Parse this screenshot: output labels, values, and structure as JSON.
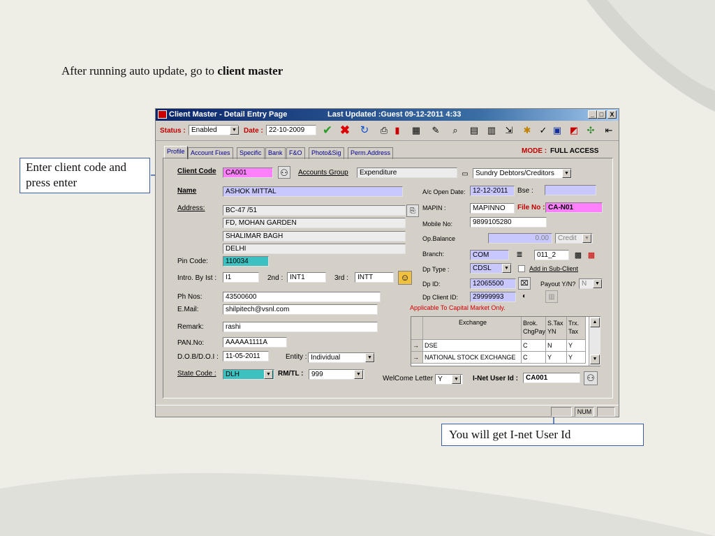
{
  "slide": {
    "title_text": "After running auto update, go to",
    "title_bold": "client  master",
    "callout_left": "Enter client code and press enter",
    "callout_bottom": "You will get I-net User Id"
  },
  "window": {
    "title": "Client Master - Detail Entry Page",
    "last_updated": "Last Updated :Guest  09-12-2011 4:33",
    "controls": {
      "min": "_",
      "max": "□",
      "close": "X"
    }
  },
  "toolbar": {
    "status_label": "Status :",
    "status_value": "Enabled",
    "date_label": "Date :",
    "date_value": "22-10-2009"
  },
  "tabs": [
    "Profile",
    "Account Fixes",
    "Specific",
    "Bank",
    "F&O",
    "Photo&Sig",
    "Perm.Address"
  ],
  "mode": {
    "label": "MODE :",
    "value": "FULL ACCESS"
  },
  "form": {
    "client_code_label": "Client Code",
    "client_code": "CA001",
    "accounts_group_label": "Accounts Group",
    "accounts_group": "Expenditure",
    "sundry": "Sundry Debtors/Creditors",
    "name_label": "Name",
    "name": "ASHOK MITTAL",
    "address_label": "Address:",
    "address": [
      "BC-47 /51",
      "FD, MOHAN GARDEN",
      "SHALIMAR BAGH",
      "DELHI"
    ],
    "pin_label": "Pin Code:",
    "pin": "110034",
    "intro_label": "Intro. By Ist :",
    "intro1": "I1",
    "intro2_label": "2nd :",
    "intro2": "INT1",
    "intro3_label": "3rd :",
    "intro3": "INTT",
    "ph_label": "Ph Nos:",
    "ph": "43500600",
    "email_label": "E.Mail:",
    "email": "shilpitech@vsnl.com",
    "remark_label": "Remark:",
    "remark": "rashi",
    "pan_label": "PAN.No:",
    "pan": "AAAAA1111A",
    "dob_label": "D.O.B/D.O.I :",
    "dob": "11-05-2011",
    "entity_label": "Entity :",
    "entity": "Individual",
    "state_label": "State Code :",
    "state": "DLH",
    "rmtl_label": "RM/TL :",
    "rmtl": "999",
    "welcome_label": "WelCome Letter :",
    "welcome": "Y",
    "inet_label": "I-Net  User Id :",
    "inet": "CA001"
  },
  "right": {
    "open_date_label": "A/c Open Date:",
    "open_date": "12-12-2011",
    "bse_label": "Bse :",
    "bse": "",
    "mapin_label": "MAPIN :",
    "mapin": "MAPINNO",
    "fileno_label": "File No :",
    "fileno": "CA-N01",
    "mobile_label": "Mobile No:",
    "mobile": "9899105280",
    "opbal_label": "Op.Balance",
    "opbal": "0.00",
    "credit": "Credit",
    "branch_label": "Branch:",
    "branch": "COM",
    "branch2": "011_2",
    "dptype_label": "Dp Type :",
    "dptype": "CDSL",
    "addsub": "Add in Sub-Client",
    "dpid_label": "Dp ID:",
    "dpid": "12065500",
    "payout_label": "Payout Y/N?",
    "payout": "N",
    "dpclient_label": "Dp Client ID:",
    "dpclient": "29999993",
    "capital_note": "Applicable To Capital Market Only."
  },
  "grid": {
    "headers": [
      "Exchange",
      "Brok. ChgPay",
      "S.Tax YN",
      "Trx. Tax"
    ],
    "rows": [
      [
        "DSE",
        "C",
        "N",
        "Y"
      ],
      [
        "NATIONAL STOCK EXCHANGE",
        "C",
        "Y",
        "Y"
      ]
    ]
  },
  "statusbar": {
    "num": "NUM"
  },
  "colors": {
    "titlebar": "#0a246a",
    "pink": "#ff80ff",
    "lavender": "#c8c8ff",
    "teal": "#3cc0c0",
    "callout_border": "#3c5ea7"
  }
}
